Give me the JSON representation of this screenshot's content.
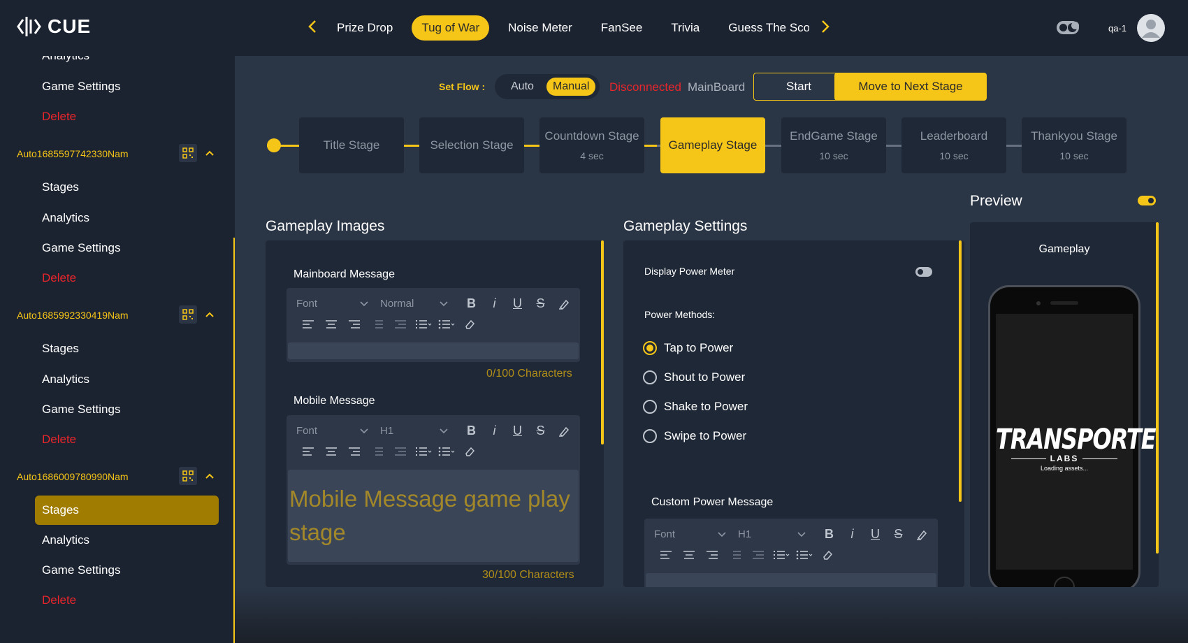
{
  "header": {
    "logo_text": "CUE",
    "tabs": [
      {
        "label": "Prize Drop",
        "active": false
      },
      {
        "label": "Tug of War",
        "active": true
      },
      {
        "label": "Noise Meter",
        "active": false
      },
      {
        "label": "FanSee",
        "active": false
      },
      {
        "label": "Trivia",
        "active": false
      },
      {
        "label": "Guess The Sco",
        "active": false
      }
    ],
    "user_name": "qa-1"
  },
  "sidebar": {
    "top_items": [
      {
        "label": "Analytics"
      },
      {
        "label": "Game Settings"
      },
      {
        "label": "Delete"
      }
    ],
    "groups": [
      {
        "name": "Auto1685597742330Nam",
        "items": [
          "Stages",
          "Analytics",
          "Game Settings",
          "Delete"
        ]
      },
      {
        "name": "Auto1685992330419Nam",
        "items": [
          "Stages",
          "Analytics",
          "Game Settings",
          "Delete"
        ]
      },
      {
        "name": "Auto1686009780990Nam",
        "items": [
          "Stages",
          "Analytics",
          "Game Settings",
          "Delete"
        ],
        "active_item": "Stages"
      }
    ]
  },
  "flow": {
    "label": "Set Flow :",
    "options": [
      "Auto",
      "Manual"
    ],
    "selected": "Manual",
    "status": "Disconnected",
    "board": "MainBoard",
    "start_label": "Start",
    "next_label": "Move to Next Stage"
  },
  "stages": [
    {
      "name": "Title Stage",
      "duration": ""
    },
    {
      "name": "Selection Stage",
      "duration": ""
    },
    {
      "name": "Countdown Stage",
      "duration": "4 sec"
    },
    {
      "name": "Gameplay Stage",
      "duration": "",
      "active": true
    },
    {
      "name": "EndGame Stage",
      "duration": "10 sec"
    },
    {
      "name": "Leaderboard",
      "duration": "10 sec"
    },
    {
      "name": "Thankyou Stage",
      "duration": "10 sec"
    }
  ],
  "images_panel": {
    "title": "Gameplay Images",
    "mainboard": {
      "label": "Mainboard Message",
      "font": "Font",
      "size": "Normal",
      "value": "",
      "count": "0/100 Characters"
    },
    "mobile": {
      "label": "Mobile Message",
      "font": "Font",
      "size": "H1",
      "value": "Mobile Message game play stage",
      "count": "30/100 Characters"
    }
  },
  "settings_panel": {
    "title": "Gameplay Settings",
    "display_power_meter": "Display Power Meter",
    "power_methods_label": "Power Methods:",
    "methods": [
      {
        "label": "Tap to Power",
        "selected": true
      },
      {
        "label": "Shout to Power",
        "selected": false
      },
      {
        "label": "Shake to Power",
        "selected": false
      },
      {
        "label": "Swipe to Power",
        "selected": false
      }
    ],
    "custom_label": "Custom Power Message",
    "custom_font": "Font",
    "custom_size": "H1"
  },
  "preview": {
    "title": "Preview",
    "enabled": true,
    "screen_title": "Gameplay",
    "brand": "TRANSPORTED",
    "brand_sub": "LABS",
    "loading": "Loading assets..."
  },
  "colors": {
    "accent": "#f5c518",
    "danger": "#e8262b",
    "panel": "#1f2836",
    "background": "#2a3546"
  }
}
